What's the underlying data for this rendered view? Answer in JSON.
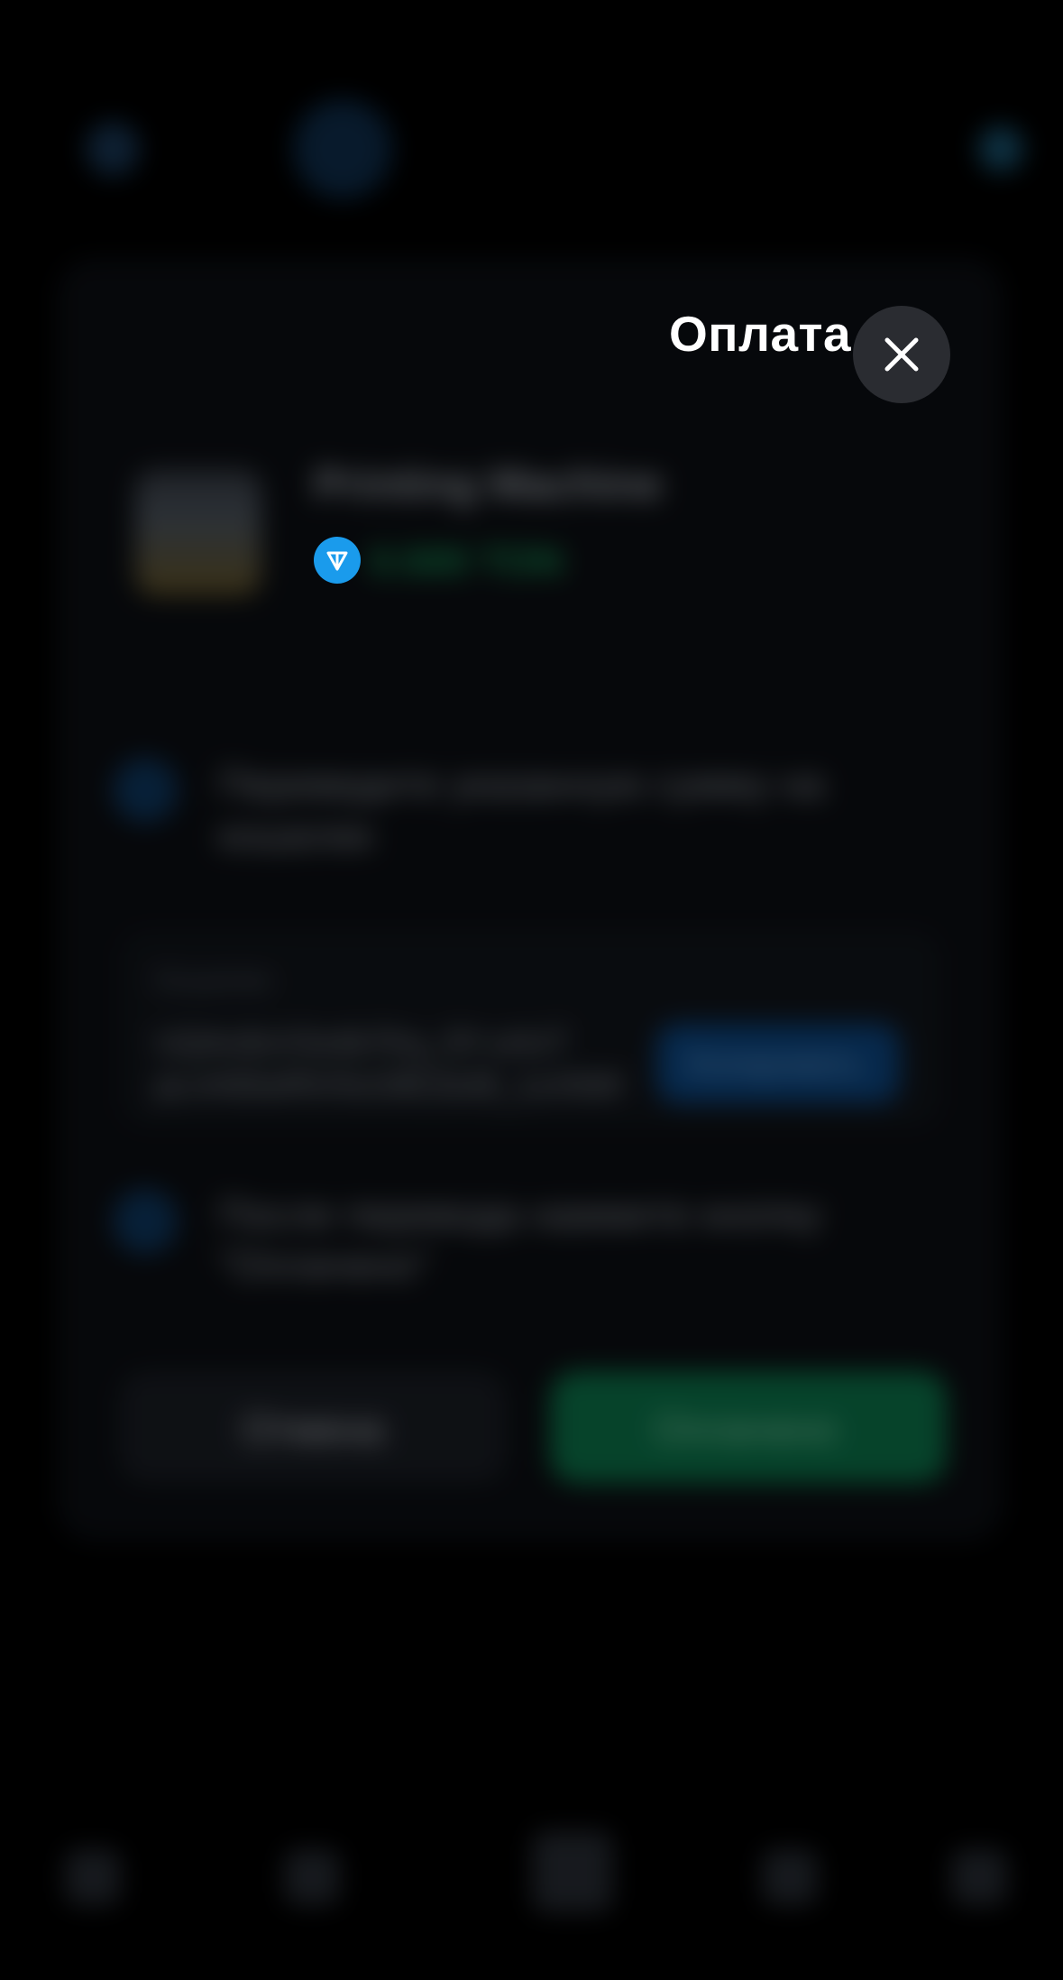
{
  "modal": {
    "title": "Оплата",
    "close_icon": "close-icon"
  },
  "product": {
    "name": "Printing Machine",
    "price": "0.500 TON",
    "currency_icon": "ton-icon"
  },
  "steps": {
    "step1_text_line1": "Переведите указанную сумму на",
    "step1_text_line2": "кошелек",
    "wallet_label": "Кошелек",
    "wallet_address_line1": "UQAc8zX3s4b7Kq_9Y-uHzT",
    "wallet_address_line2": "pLmN0wRtV5cGfE2dJ8_1uVbW",
    "copy_button": "Копировать",
    "step2_text_line1": "После перевода нажмите кнопку",
    "step2_text_line2": "\"Оплачено\""
  },
  "actions": {
    "cancel": "Отмена",
    "paid": "Оплачено"
  },
  "colors": {
    "ton_blue": "#1A9BEC",
    "close_bg": "#2A2C31",
    "title_text": "#FFFFFF"
  }
}
